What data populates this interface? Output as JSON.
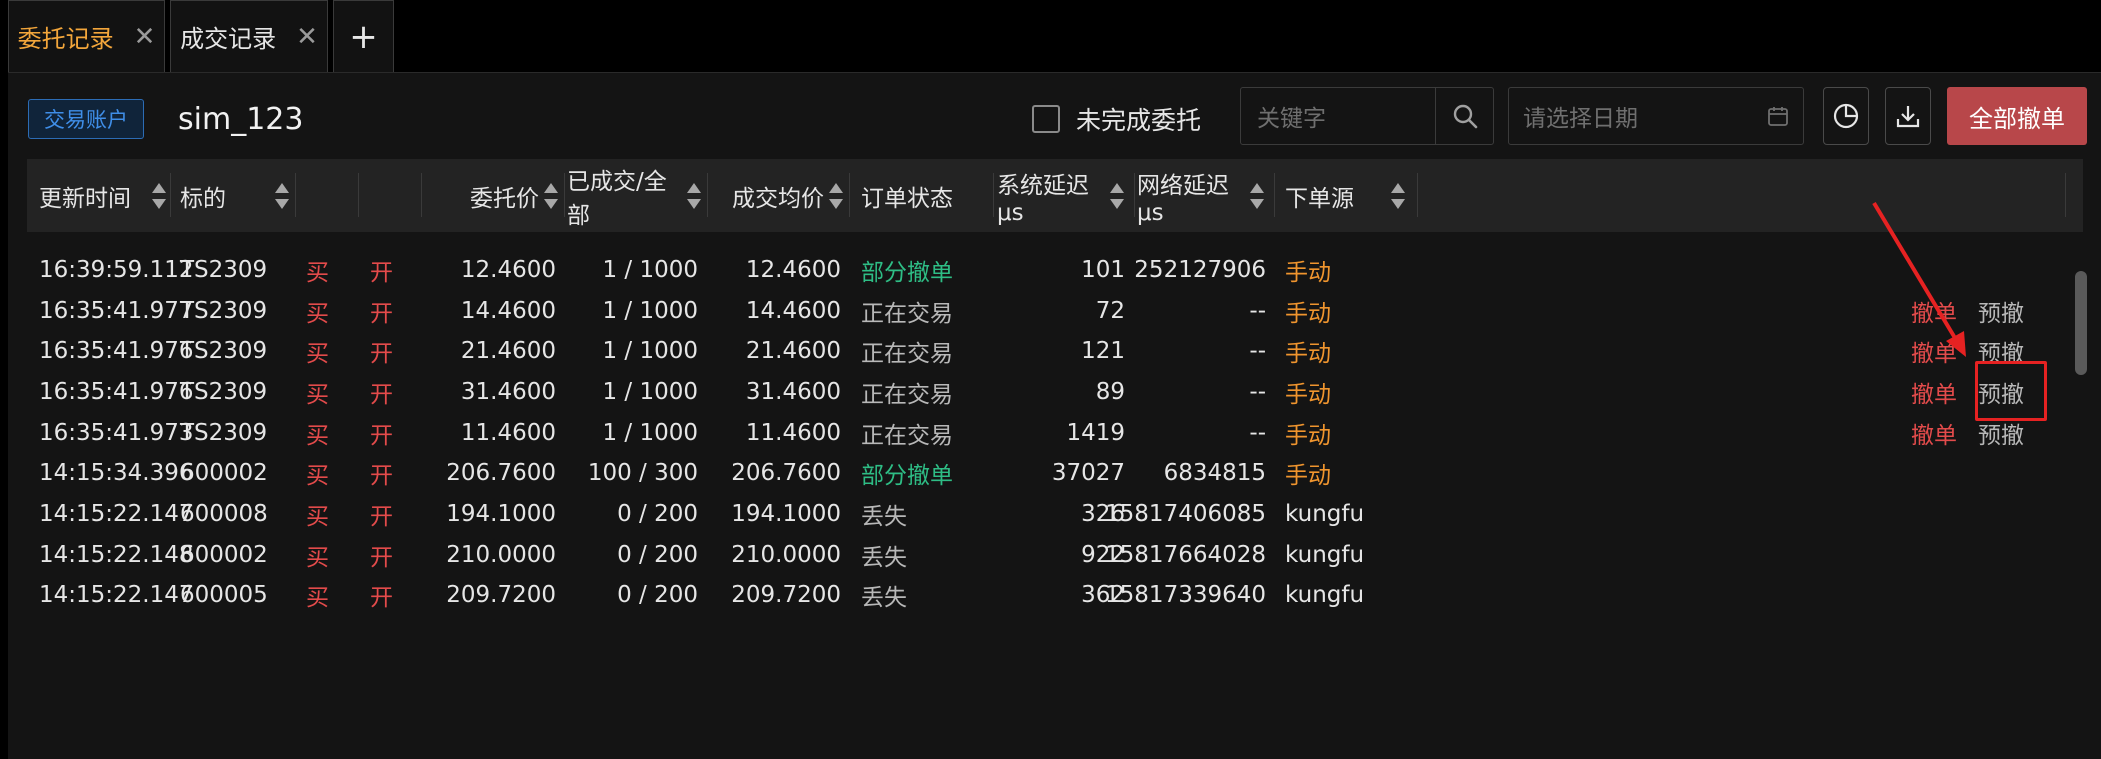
{
  "tabs": [
    {
      "label": "委托记录",
      "active": true
    },
    {
      "label": "成交记录",
      "active": false
    }
  ],
  "tab_add_label": "+",
  "tab_close_glyph": "✕",
  "toolbar": {
    "account_tag": "交易账户",
    "account_name": "sim_123",
    "unfinished_label": "未完成委托",
    "unfinished_checked": false,
    "search_placeholder": "关键字",
    "date_placeholder": "请选择日期",
    "cancel_all_label": "全部撤单"
  },
  "icons": {
    "search": "search-icon",
    "calendar": "calendar-icon",
    "chart": "pie-chart-icon",
    "download": "download-icon",
    "sort": "sort-icon",
    "close": "close-icon"
  },
  "colors": {
    "active_tab": "#f3a63b",
    "buy_open": "#e34b4b",
    "partial_cancel": "#2ebd85",
    "manual_source": "#f0952e",
    "cancel_all_bg": "#b8474a",
    "annotation": "#e62222"
  },
  "table": {
    "headers": {
      "time": "更新时间",
      "symbol": "标的",
      "price": "委托价",
      "filled": "已成交/全部",
      "avg": "成交均价",
      "status": "订单状态",
      "sys_latency": "系统延迟 μs",
      "net_latency": "网络延迟 μs",
      "source": "下单源"
    },
    "rows": [
      {
        "time": "16:39:59.112",
        "symbol": "TS2309",
        "side": "买",
        "offset": "开",
        "price": "12.4600",
        "filled": "1 / 1000",
        "avg": "12.4600",
        "status": "部分撤单",
        "status_type": "partial",
        "sys": "101",
        "net": "252127906",
        "source": "手动",
        "source_type": "manual",
        "cancel": "",
        "precancel": ""
      },
      {
        "time": "16:35:41.977",
        "symbol": "TS2309",
        "side": "买",
        "offset": "开",
        "price": "14.4600",
        "filled": "1 / 1000",
        "avg": "14.4600",
        "status": "正在交易",
        "status_type": "trading",
        "sys": "72",
        "net": "--",
        "source": "手动",
        "source_type": "manual",
        "cancel": "撤单",
        "precancel": "预撤"
      },
      {
        "time": "16:35:41.976",
        "symbol": "TS2309",
        "side": "买",
        "offset": "开",
        "price": "21.4600",
        "filled": "1 / 1000",
        "avg": "21.4600",
        "status": "正在交易",
        "status_type": "trading",
        "sys": "121",
        "net": "--",
        "source": "手动",
        "source_type": "manual",
        "cancel": "撤单",
        "precancel": "预撤"
      },
      {
        "time": "16:35:41.976",
        "symbol": "TS2309",
        "side": "买",
        "offset": "开",
        "price": "31.4600",
        "filled": "1 / 1000",
        "avg": "31.4600",
        "status": "正在交易",
        "status_type": "trading",
        "sys": "89",
        "net": "--",
        "source": "手动",
        "source_type": "manual",
        "cancel": "撤单",
        "precancel": "预撤"
      },
      {
        "time": "16:35:41.973",
        "symbol": "TS2309",
        "side": "买",
        "offset": "开",
        "price": "11.4600",
        "filled": "1 / 1000",
        "avg": "11.4600",
        "status": "正在交易",
        "status_type": "trading",
        "sys": "1419",
        "net": "--",
        "source": "手动",
        "source_type": "manual",
        "cancel": "撤单",
        "precancel": "预撤"
      },
      {
        "time": "14:15:34.396",
        "symbol": "600002",
        "side": "买",
        "offset": "开",
        "price": "206.7600",
        "filled": "100 / 300",
        "avg": "206.7600",
        "status": "部分撤单",
        "status_type": "partial",
        "sys": "37027",
        "net": "6834815",
        "source": "手动",
        "source_type": "manual",
        "cancel": "",
        "precancel": ""
      },
      {
        "time": "14:15:22.147",
        "symbol": "600008",
        "side": "买",
        "offset": "开",
        "price": "194.1000",
        "filled": "0 / 200",
        "avg": "194.1000",
        "status": "丢失",
        "status_type": "lost",
        "sys": "326",
        "net": "15817406085",
        "source": "kungfu",
        "source_type": "system",
        "cancel": "",
        "precancel": ""
      },
      {
        "time": "14:15:22.148",
        "symbol": "600002",
        "side": "买",
        "offset": "开",
        "price": "210.0000",
        "filled": "0 / 200",
        "avg": "210.0000",
        "status": "丢失",
        "status_type": "lost",
        "sys": "922",
        "net": "15817664028",
        "source": "kungfu",
        "source_type": "system",
        "cancel": "",
        "precancel": ""
      },
      {
        "time": "14:15:22.147",
        "symbol": "600005",
        "side": "买",
        "offset": "开",
        "price": "209.7200",
        "filled": "0 / 200",
        "avg": "209.7200",
        "status": "丢失",
        "status_type": "lost",
        "sys": "362",
        "net": "15817339640",
        "source": "kungfu",
        "source_type": "system",
        "cancel": "",
        "precancel": ""
      }
    ]
  }
}
